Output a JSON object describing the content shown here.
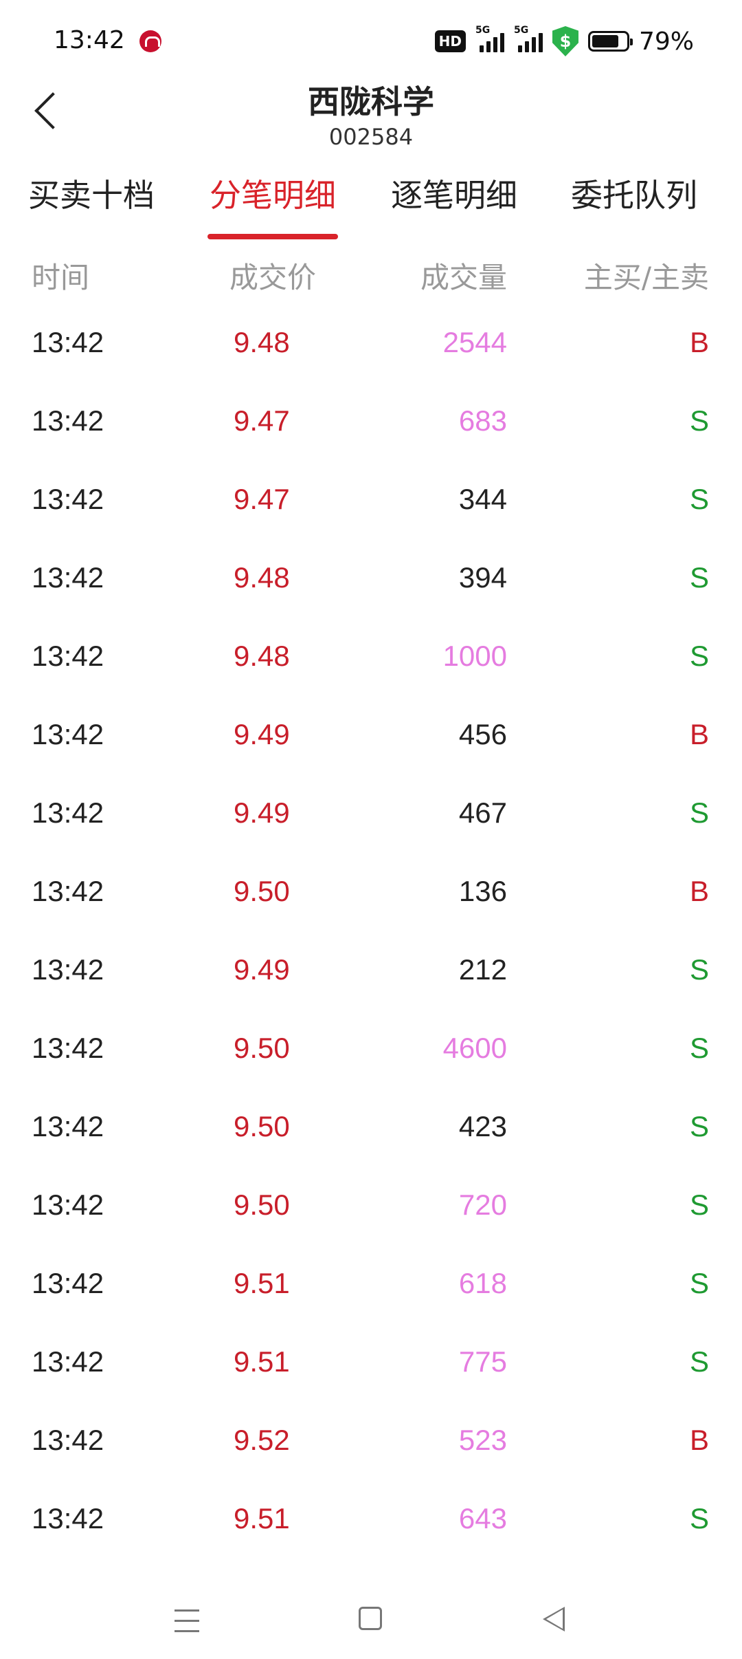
{
  "status_bar": {
    "time": "13:42",
    "hd_label": "HD",
    "network_1": "5G",
    "network_2": "5G",
    "battery": "79%"
  },
  "header": {
    "title": "西陇科学",
    "code": "002584"
  },
  "tabs": [
    {
      "label": "买卖十档",
      "active": false
    },
    {
      "label": "分笔明细",
      "active": true
    },
    {
      "label": "逐笔明细",
      "active": false
    },
    {
      "label": "委托队列",
      "active": false
    }
  ],
  "columns": {
    "time": "时间",
    "price": "成交价",
    "volume": "成交量",
    "side": "主买/主卖"
  },
  "rows": [
    {
      "time": "13:42",
      "price": "9.48",
      "volume": "2544",
      "big": true,
      "side": "B"
    },
    {
      "time": "13:42",
      "price": "9.47",
      "volume": "683",
      "big": true,
      "side": "S"
    },
    {
      "time": "13:42",
      "price": "9.47",
      "volume": "344",
      "big": false,
      "side": "S"
    },
    {
      "time": "13:42",
      "price": "9.48",
      "volume": "394",
      "big": false,
      "side": "S"
    },
    {
      "time": "13:42",
      "price": "9.48",
      "volume": "1000",
      "big": true,
      "side": "S"
    },
    {
      "time": "13:42",
      "price": "9.49",
      "volume": "456",
      "big": false,
      "side": "B"
    },
    {
      "time": "13:42",
      "price": "9.49",
      "volume": "467",
      "big": false,
      "side": "S"
    },
    {
      "time": "13:42",
      "price": "9.50",
      "volume": "136",
      "big": false,
      "side": "B"
    },
    {
      "time": "13:42",
      "price": "9.49",
      "volume": "212",
      "big": false,
      "side": "S"
    },
    {
      "time": "13:42",
      "price": "9.50",
      "volume": "4600",
      "big": true,
      "side": "S"
    },
    {
      "time": "13:42",
      "price": "9.50",
      "volume": "423",
      "big": false,
      "side": "S"
    },
    {
      "time": "13:42",
      "price": "9.50",
      "volume": "720",
      "big": true,
      "side": "S"
    },
    {
      "time": "13:42",
      "price": "9.51",
      "volume": "618",
      "big": true,
      "side": "S"
    },
    {
      "time": "13:42",
      "price": "9.51",
      "volume": "775",
      "big": true,
      "side": "S"
    },
    {
      "time": "13:42",
      "price": "9.52",
      "volume": "523",
      "big": true,
      "side": "B"
    },
    {
      "time": "13:42",
      "price": "9.51",
      "volume": "643",
      "big": true,
      "side": "S"
    }
  ],
  "colors": {
    "accent": "#d9232a",
    "price": "#c81e2a",
    "buy": "#c81e2a",
    "sell": "#1f9a32",
    "big_volume": "#e57ce0"
  }
}
